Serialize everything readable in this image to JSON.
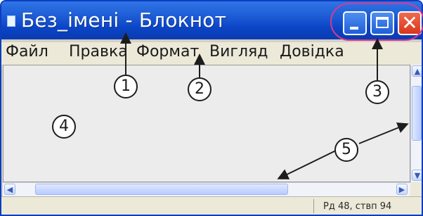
{
  "window": {
    "title": "Без_імені - Блокнот"
  },
  "icons": {
    "app": "notepad-icon",
    "minimize": "minimize-icon",
    "maximize": "maximize-icon",
    "close": "close-icon",
    "scroll_up": "arrow-up-icon",
    "scroll_down": "arrow-down-icon",
    "scroll_left": "arrow-left-icon",
    "scroll_right": "arrow-right-icon"
  },
  "glyphs": {
    "close": "✕",
    "up": "▲",
    "down": "▼",
    "left": "◀",
    "right": "▶"
  },
  "menu": [
    {
      "label": "Файл"
    },
    {
      "label": "Правка"
    },
    {
      "label": "Формат"
    },
    {
      "label": "Вигляд"
    },
    {
      "label": "Довідка"
    }
  ],
  "editor": {
    "content": ""
  },
  "status": {
    "text": "Рд 48, ствп 94"
  },
  "callouts": [
    "1",
    "2",
    "3",
    "4",
    "5"
  ],
  "colors": {
    "titlebar": "#0b44c6",
    "close_button": "#d9361a",
    "highlight": "#d8398f"
  }
}
